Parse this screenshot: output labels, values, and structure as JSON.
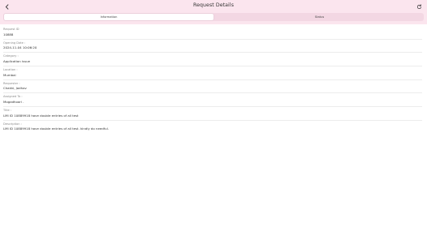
{
  "header": {
    "title": "Request Details",
    "back_icon": "chevron-left-icon",
    "refresh_icon": "refresh-icon"
  },
  "tabs": [
    {
      "label": "Information",
      "active": true
    },
    {
      "label": "Status",
      "active": false
    }
  ],
  "fields": [
    {
      "label": "Request ID",
      "value": "10888"
    },
    {
      "label": "Opening Date :",
      "value": "2024-11-04 10:06:20"
    },
    {
      "label": "Category :",
      "value": "Application issue"
    },
    {
      "label": "Location :",
      "value": "Mumbai"
    },
    {
      "label": "Requester :",
      "value": "Chakki, Jadhav"
    },
    {
      "label": "Assigned To :",
      "value": "Mogadhoori ."
    },
    {
      "label": "Title :",
      "value": "LMI ID 10889918 have double entries of all test"
    },
    {
      "label": "Description :",
      "value": "LMI ID 10889918 have double entries of all test. kindly do needful."
    }
  ],
  "colors": {
    "header_bg": "#fbe5ee",
    "tabs_bg": "#f3d7e3",
    "active_tab_bg": "#ffffff"
  }
}
